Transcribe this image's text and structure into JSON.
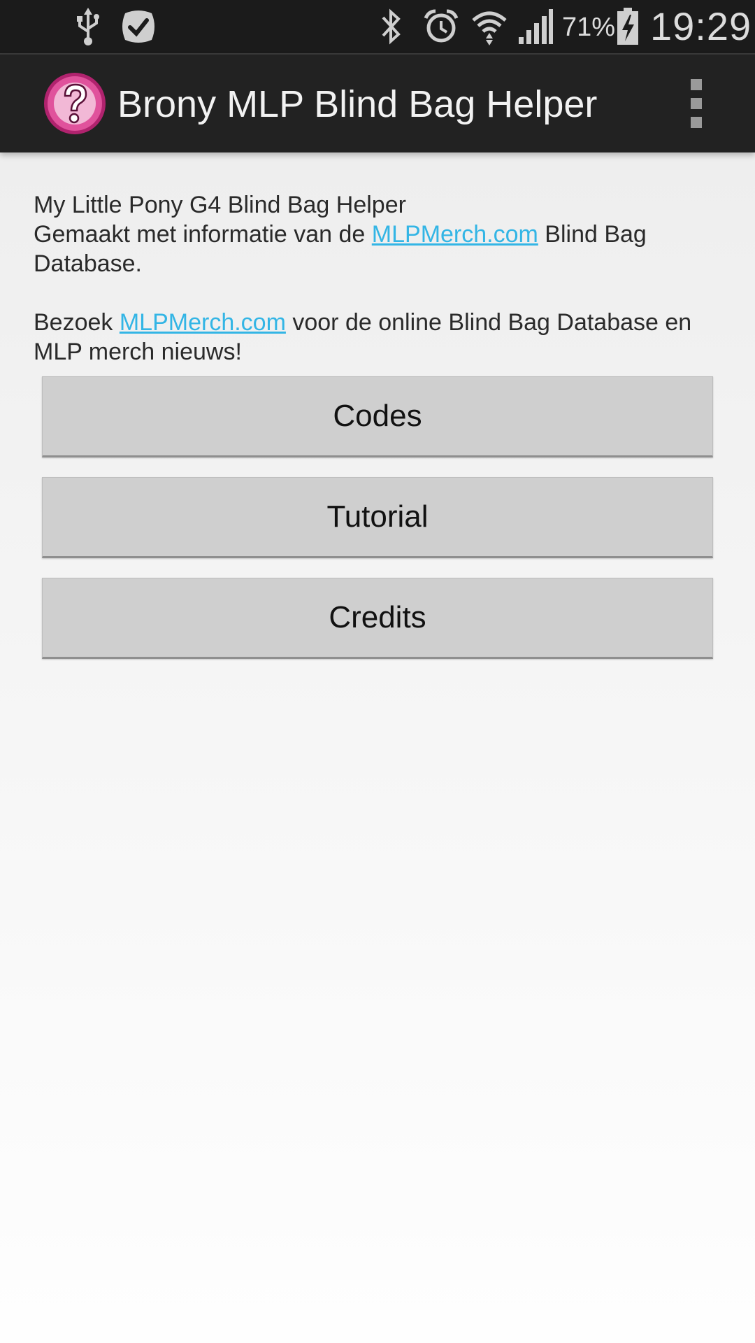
{
  "status_bar": {
    "icons_left": [
      "usb-icon",
      "task-check-icon"
    ],
    "icons_right": [
      "bluetooth-icon",
      "alarm-icon",
      "wifi-icon",
      "signal-icon",
      "battery-charging-icon"
    ],
    "battery_percent": "71%",
    "time": "19:29"
  },
  "action_bar": {
    "title": "Brony MLP Blind Bag Helper",
    "logo_icon": "question-mark-logo-icon",
    "menu_icon": "overflow-menu-icon",
    "colors": {
      "background": "#222222",
      "logo_pink": "#e0529c",
      "logo_light": "#f2b8d6"
    }
  },
  "intro": {
    "line1": "My Little Pony G4 Blind Bag Helper",
    "line2_prefix": "Gemaakt met informatie van de ",
    "line2_link": "MLPMerch.com",
    "line2_suffix": " Blind Bag Database.",
    "line3_prefix": "Bezoek ",
    "line3_link": "MLPMerch.com",
    "line3_suffix": " voor de online Blind Bag Database en MLP merch nieuws!",
    "link_color": "#33b5e5"
  },
  "buttons": {
    "codes": "Codes",
    "tutorial": "Tutorial",
    "credits": "Credits"
  }
}
